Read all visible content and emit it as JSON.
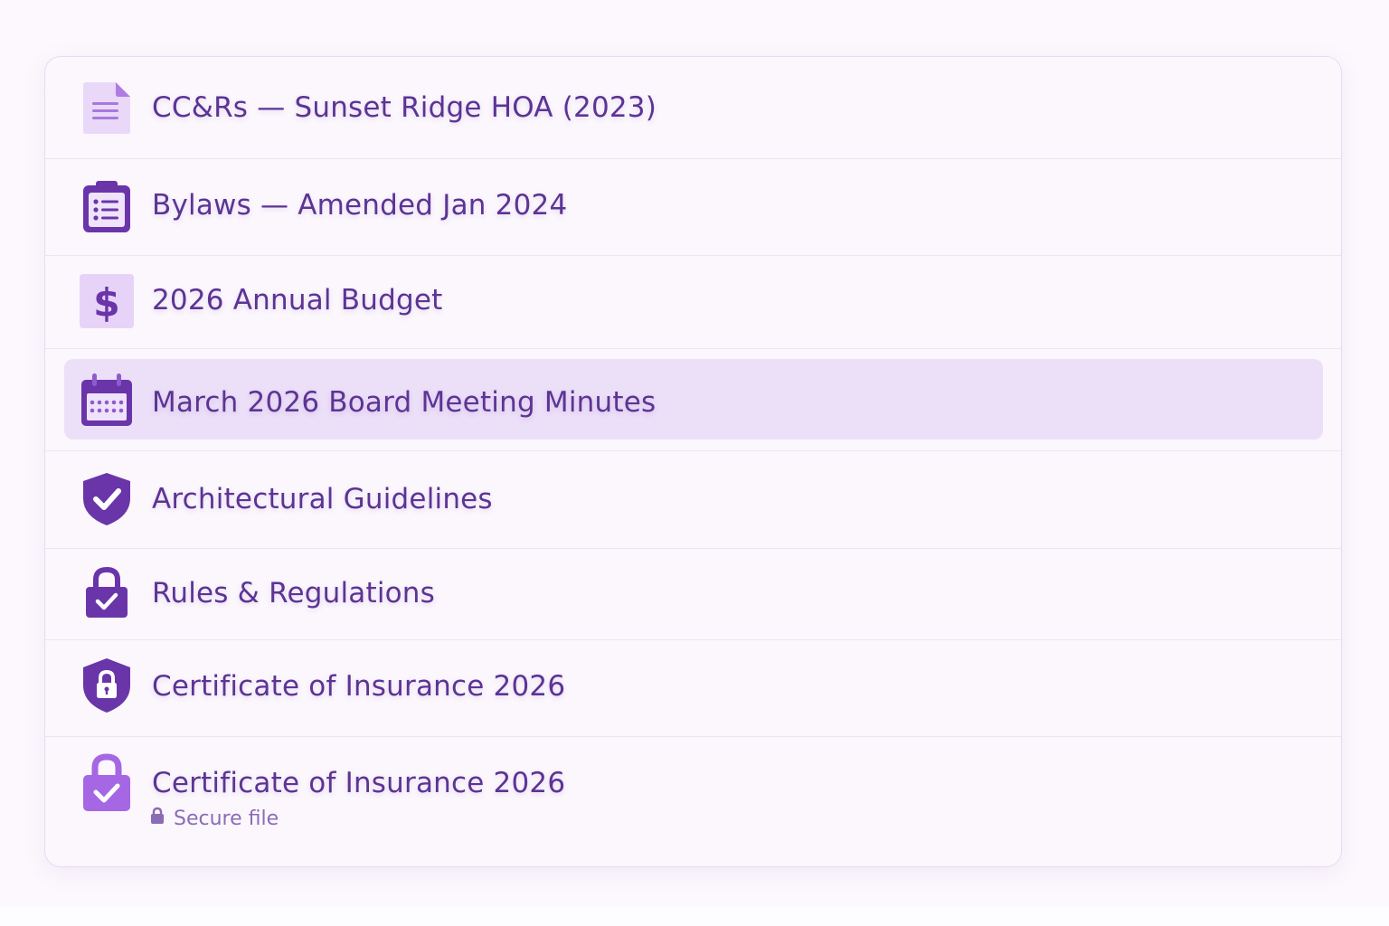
{
  "documents": [
    {
      "title": "CC&Rs — Sunset Ridge HOA (2023)",
      "icon": "document-icon"
    },
    {
      "title": "Bylaws — Amended Jan 2024",
      "icon": "clipboard-list-icon"
    },
    {
      "title": "2026 Annual Budget",
      "icon": "dollar-icon"
    },
    {
      "title": "March 2026 Board Meeting Minutes",
      "icon": "calendar-icon",
      "selected": true
    },
    {
      "title": "Architectural Guidelines",
      "icon": "shield-check-icon"
    },
    {
      "title": "Rules & Regulations",
      "icon": "lock-check-icon"
    },
    {
      "title": "Certificate of Insurance 2026",
      "icon": "shield-lock-icon"
    },
    {
      "title": "Certificate of Insurance 2026",
      "icon": "lock-check-light-icon",
      "note": "Secure file",
      "note_icon": "small-lock-icon"
    }
  ],
  "colors": {
    "text": "#5c3494",
    "accent": "#6a35a8",
    "selected_bg": "#ecdff8",
    "panel_bg": "#fbf7fd",
    "page_bg": "#fcf8fd"
  }
}
